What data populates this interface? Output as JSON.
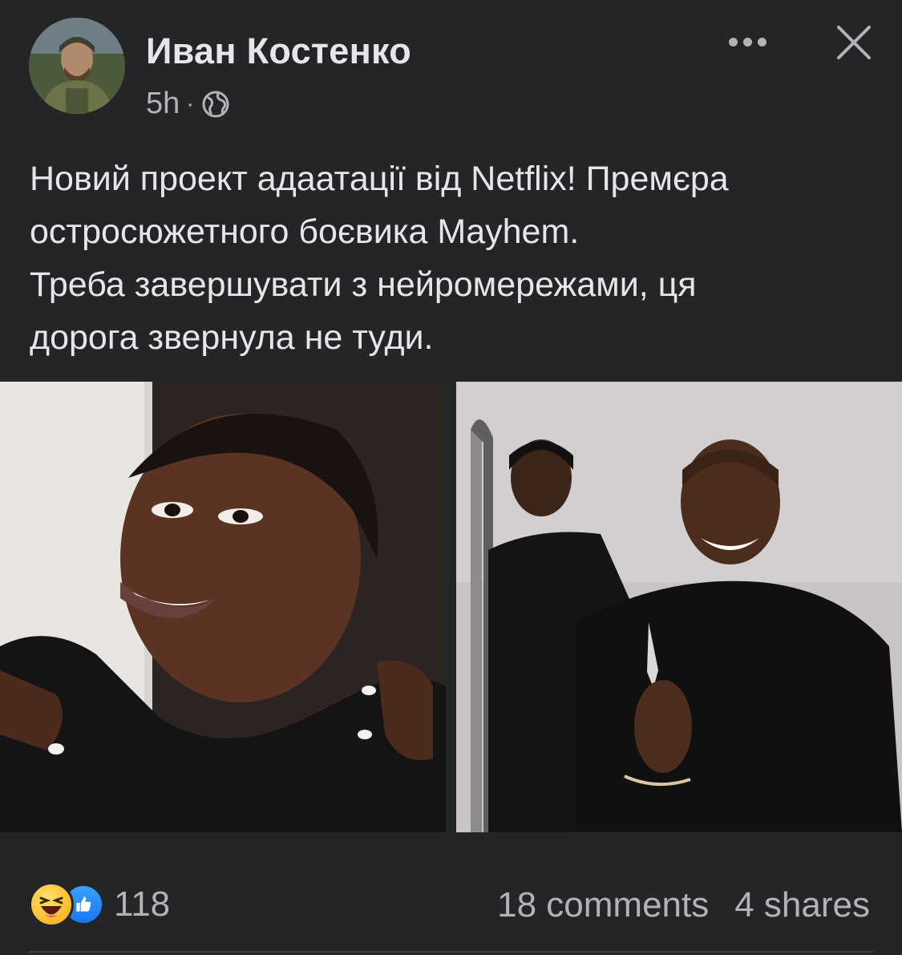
{
  "post": {
    "author": "Иван Костенко",
    "time": "5h",
    "separator": "·",
    "privacy_icon": "globe-icon",
    "text_lines": [
      "Новий проект адаатації від Netflix! Премєра",
      "остросюжетного боєвика Mayhem.",
      "Треба завершувати з нейромережами, ця",
      "дорога звернула не туди."
    ]
  },
  "photos": [
    {
      "name": "photo-portrait-smiling-woman"
    },
    {
      "name": "photo-two-women-with-knife"
    }
  ],
  "footer": {
    "reaction_icons": [
      "haha-reaction-icon",
      "like-reaction-icon"
    ],
    "reaction_count": "118",
    "comments": "18 comments",
    "shares": "4 shares"
  },
  "colors": {
    "background": "#242526",
    "primary_text": "#e4e6eb",
    "secondary_text": "#b0b3b8",
    "like_blue": "#1877f2",
    "haha_yellow": "#f7b928"
  }
}
